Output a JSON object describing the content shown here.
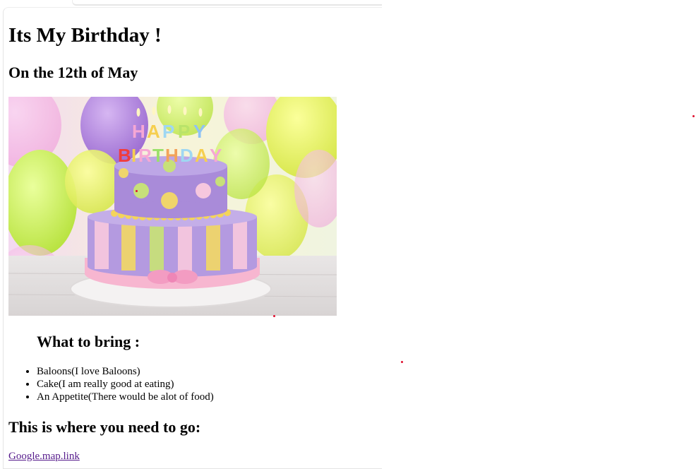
{
  "page": {
    "title": "Its My Birthday !",
    "subtitle": "On the 12th of May",
    "image": {
      "alt": "Happy Birthday cake",
      "candle_text_line1": "HAPPY",
      "candle_text_line2": "BIRTHDAY"
    },
    "bring_heading": "What to bring :",
    "bring_items": [
      "Baloons(I love Baloons)",
      "Cake(I am really good at eating)",
      "An Appetite(There would be alot of food)"
    ],
    "location_heading": "This is where you need to go:",
    "map_link": "Google.map.link"
  },
  "colors": {
    "link": "#551a8b",
    "marker": "#e0102f"
  }
}
